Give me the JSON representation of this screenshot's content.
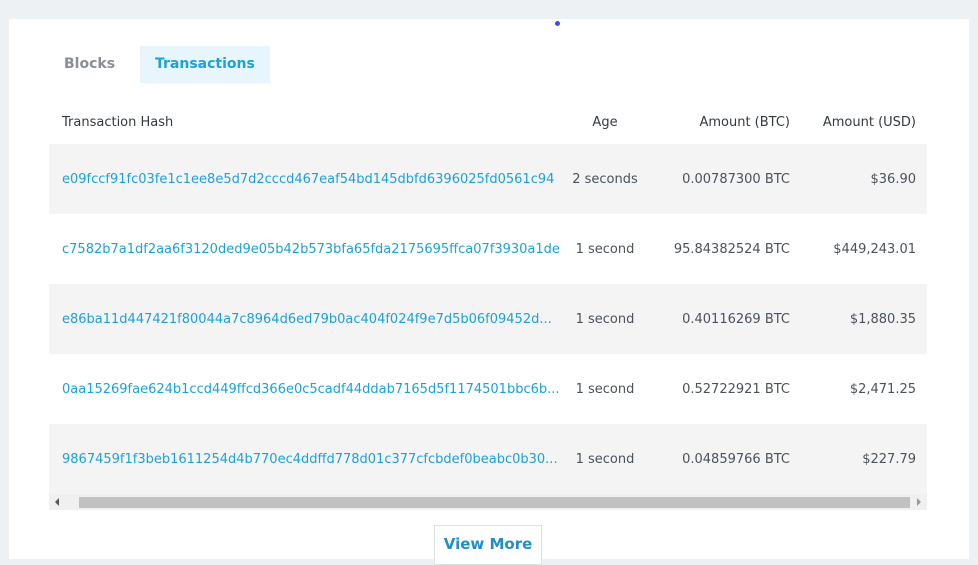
{
  "tabs": [
    {
      "label": "Blocks",
      "active": false
    },
    {
      "label": "Transactions",
      "active": true
    }
  ],
  "table": {
    "headers": {
      "hash": "Transaction Hash",
      "age": "Age",
      "btc": "Amount (BTC)",
      "usd": "Amount (USD)"
    },
    "rows": [
      {
        "hash": "e09fccf91fc03fe1c1ee8e5d7d2cccd467eaf54bd145dbfd6396025fd0561c94",
        "age": "2 seconds",
        "btc": "0.00787300 BTC",
        "usd": "$36.90"
      },
      {
        "hash": "c7582b7a1df2aa6f3120ded9e05b42b573bfa65fda2175695ffca07f3930a1de",
        "age": "1 second",
        "btc": "95.84382524 BTC",
        "usd": "$449,243.01"
      },
      {
        "hash": "e86ba11d447421f80044a7c8964d6ed79b0ac404f024f9e7d5b06f09452d...",
        "age": "1 second",
        "btc": "0.40116269 BTC",
        "usd": "$1,880.35"
      },
      {
        "hash": "0aa15269fae624b1ccd449ffcd366e0c5cadf44ddab7165d5f1174501bbc6b...",
        "age": "1 second",
        "btc": "0.52722921 BTC",
        "usd": "$2,471.25"
      },
      {
        "hash": "9867459f1f3beb1611254d4b770ec4ddffd778d01c377cfcbdef0beabc0b30...",
        "age": "1 second",
        "btc": "0.04859766 BTC",
        "usd": "$227.79"
      }
    ]
  },
  "view_more_label": "View More",
  "colors": {
    "accent": "#1ba2d8",
    "active_tab_bg": "#e6f6fc",
    "row_alt_bg": "#f4f4f5",
    "loading_dot": "#3d4fd8"
  },
  "icons": {
    "loading": "loading-dot-icon",
    "scroll_left": "scroll-left-arrow-icon",
    "scroll_right": "scroll-right-arrow-icon"
  }
}
